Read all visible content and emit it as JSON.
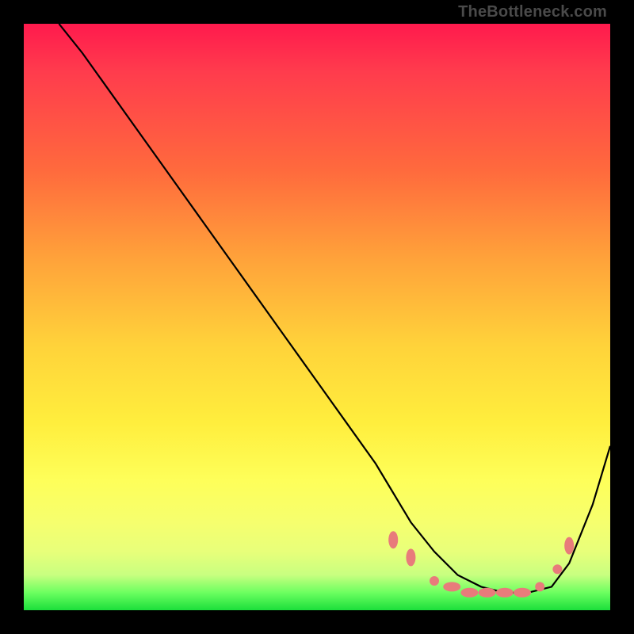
{
  "attribution": "TheBottleneck.com",
  "chart_data": {
    "type": "line",
    "title": "",
    "xlabel": "",
    "ylabel": "",
    "xlim": [
      0,
      100
    ],
    "ylim": [
      0,
      100
    ],
    "series": [
      {
        "name": "bottleneck-curve",
        "x": [
          6,
          10,
          15,
          20,
          25,
          30,
          35,
          40,
          45,
          50,
          55,
          60,
          63,
          66,
          70,
          74,
          78,
          82,
          86,
          90,
          93,
          97,
          100
        ],
        "y": [
          100,
          95,
          88,
          81,
          74,
          67,
          60,
          53,
          46,
          39,
          32,
          25,
          20,
          15,
          10,
          6,
          4,
          3,
          3,
          4,
          8,
          18,
          28
        ]
      }
    ],
    "markers": [
      {
        "x": 63,
        "y": 12,
        "shape": "oval"
      },
      {
        "x": 66,
        "y": 9,
        "shape": "oval"
      },
      {
        "x": 70,
        "y": 5,
        "shape": "round"
      },
      {
        "x": 73,
        "y": 4,
        "shape": "oval-h"
      },
      {
        "x": 76,
        "y": 3,
        "shape": "oval-h"
      },
      {
        "x": 79,
        "y": 3,
        "shape": "oval-h"
      },
      {
        "x": 82,
        "y": 3,
        "shape": "oval-h"
      },
      {
        "x": 85,
        "y": 3,
        "shape": "oval-h"
      },
      {
        "x": 88,
        "y": 4,
        "shape": "round"
      },
      {
        "x": 91,
        "y": 7,
        "shape": "round"
      },
      {
        "x": 93,
        "y": 11,
        "shape": "oval"
      }
    ],
    "marker_color": "#e87b7b",
    "curve_color": "#000000"
  }
}
